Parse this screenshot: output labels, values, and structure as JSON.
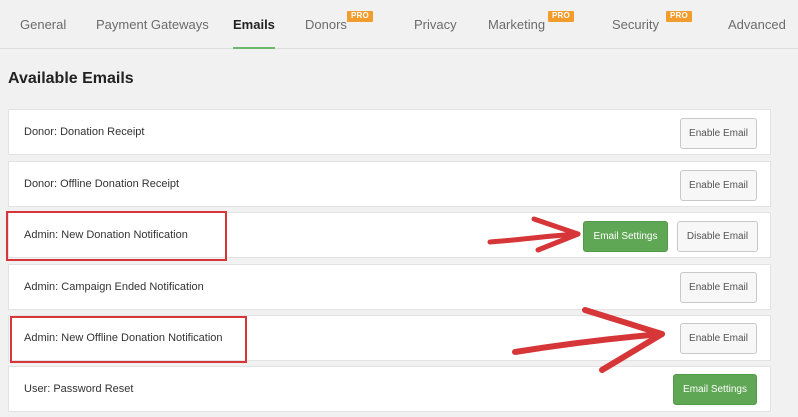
{
  "tabs": [
    {
      "label": "General",
      "pro": ""
    },
    {
      "label": "Payment Gateways",
      "pro": ""
    },
    {
      "label": "Emails",
      "pro": ""
    },
    {
      "label": "Donors",
      "pro": "PRO"
    },
    {
      "label": "Privacy",
      "pro": ""
    },
    {
      "label": "Marketing",
      "pro": "PRO"
    },
    {
      "label": "Security",
      "pro": "PRO"
    },
    {
      "label": "Advanced",
      "pro": ""
    }
  ],
  "heading": "Available Emails",
  "emails": [
    {
      "label": "Donor: Donation Receipt",
      "primary_button": "",
      "secondary_button": "Enable Email"
    },
    {
      "label": "Donor: Offline Donation Receipt",
      "primary_button": "",
      "secondary_button": "Enable Email"
    },
    {
      "label": "Admin: New Donation Notification",
      "primary_button": "Email Settings",
      "secondary_button": "Disable Email"
    },
    {
      "label": "Admin: Campaign Ended Notification",
      "primary_button": "",
      "secondary_button": "Enable Email"
    },
    {
      "label": "Admin: New Offline Donation Notification",
      "primary_button": "",
      "secondary_button": "Enable Email"
    },
    {
      "label": "User: Password Reset",
      "primary_button": "Email Settings",
      "secondary_button": ""
    }
  ],
  "colors": {
    "accent": "#69b86b",
    "primary_button": "#5fa655",
    "pro_badge": "#f39c2e",
    "annotation": "#d63638"
  }
}
